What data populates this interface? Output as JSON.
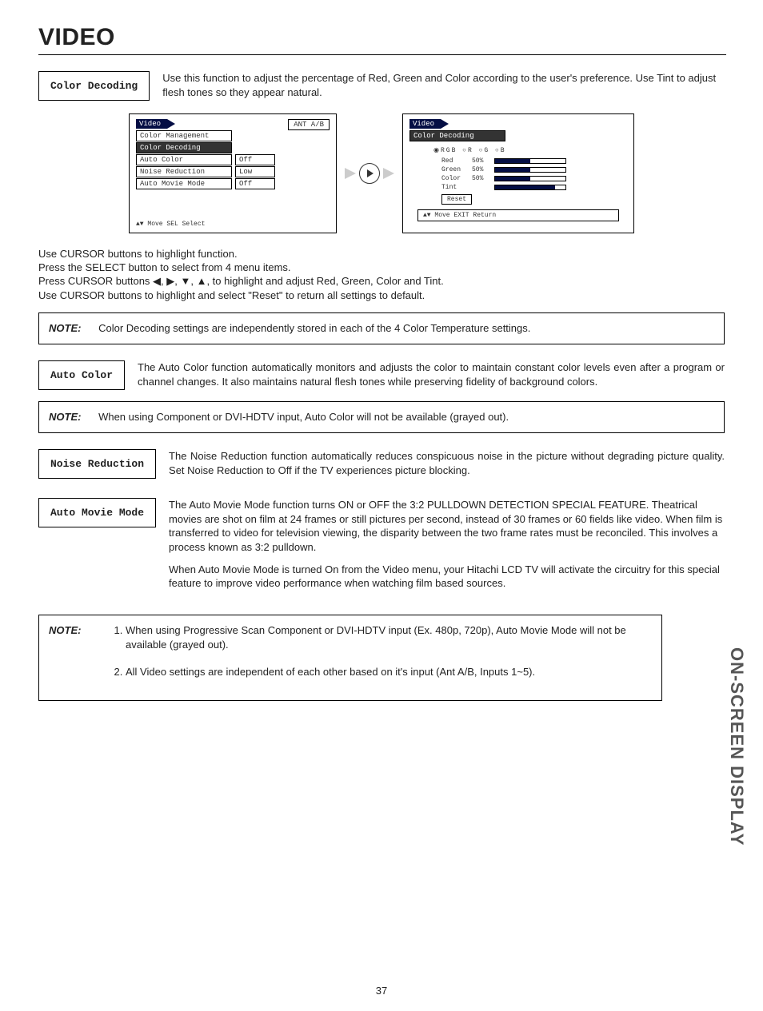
{
  "page_title": "VIDEO",
  "sidebar": "ON-SCREEN DISPLAY",
  "page_number": "37",
  "color_decoding": {
    "label": "Color Decoding",
    "desc": "Use this function to adjust the percentage of Red, Green and Color according to the user's preference. Use Tint to adjust flesh tones so they appear natural."
  },
  "osd1": {
    "title": "Video",
    "antab": "ANT A/B",
    "items": [
      {
        "name": "Color Management",
        "val": ""
      },
      {
        "name": "Color Decoding",
        "val": "",
        "selected": true
      },
      {
        "name": "Auto Color",
        "val": "Off"
      },
      {
        "name": "Noise Reduction",
        "val": "Low"
      },
      {
        "name": "Auto Movie Mode",
        "val": "Off"
      }
    ],
    "footer": "▲▼ Move  SEL Select"
  },
  "osd2": {
    "title": "Video",
    "subtitle": "Color Decoding",
    "radios": "◉RGB   ○R   ○G   ○B",
    "sliders": [
      {
        "lbl": "Red",
        "pct": "50%",
        "fill": 50
      },
      {
        "lbl": "Green",
        "pct": "50%",
        "fill": 50
      },
      {
        "lbl": "Color",
        "pct": "50%",
        "fill": 50
      },
      {
        "lbl": "Tint",
        "pct": "",
        "fill": 85
      }
    ],
    "reset": "Reset",
    "footer": "▲▼ Move          EXIT Return"
  },
  "instructions": {
    "l1": "Use CURSOR buttons to highlight function.",
    "l2": "Press the SELECT button to select from 4 menu items.",
    "l3": "Press CURSOR buttons ◀, ▶, ▼, ▲, to highlight and adjust Red, Green, Color and Tint.",
    "l4": "Use CURSOR buttons to highlight and select \"Reset\" to return all settings to default."
  },
  "note1": {
    "label": "NOTE:",
    "text": "Color Decoding settings are independently stored in each of the 4 Color Temperature settings."
  },
  "auto_color": {
    "label": "Auto Color",
    "desc": "The Auto Color function automatically monitors and adjusts the color to maintain constant color levels even after a program or channel changes. It also maintains natural flesh tones while preserving fidelity of background colors."
  },
  "note2": {
    "label": "NOTE:",
    "text": "When using Component or DVI-HDTV input, Auto Color will not be available (grayed out)."
  },
  "noise_reduction": {
    "label": "Noise Reduction",
    "desc": "The Noise Reduction function automatically reduces conspicuous noise in the picture without degrading picture quality.  Set Noise Reduction to Off if the TV experiences picture blocking."
  },
  "auto_movie": {
    "label": "Auto Movie Mode",
    "desc1": "The Auto Movie Mode function turns ON or OFF the 3:2 PULLDOWN DETECTION SPECIAL FEATURE. Theatrical movies are shot on film at 24 frames or still pictures per second, instead of 30 frames or 60 fields like video.  When film is transferred to video for television viewing, the disparity between the two frame rates must be reconciled.  This involves a process known as 3:2 pulldown.",
    "desc2": "When Auto Movie Mode is turned On from the Video menu, your Hitachi LCD TV will activate the circuitry for this special feature to improve video performance when watching film based sources."
  },
  "note3": {
    "label": "NOTE:",
    "item1": "When using Progressive Scan Component or DVI-HDTV input (Ex. 480p, 720p), Auto Movie Mode will not be available (grayed out).",
    "item2": "All Video settings are independent of each other based on it's input (Ant A/B, Inputs 1~5)."
  }
}
